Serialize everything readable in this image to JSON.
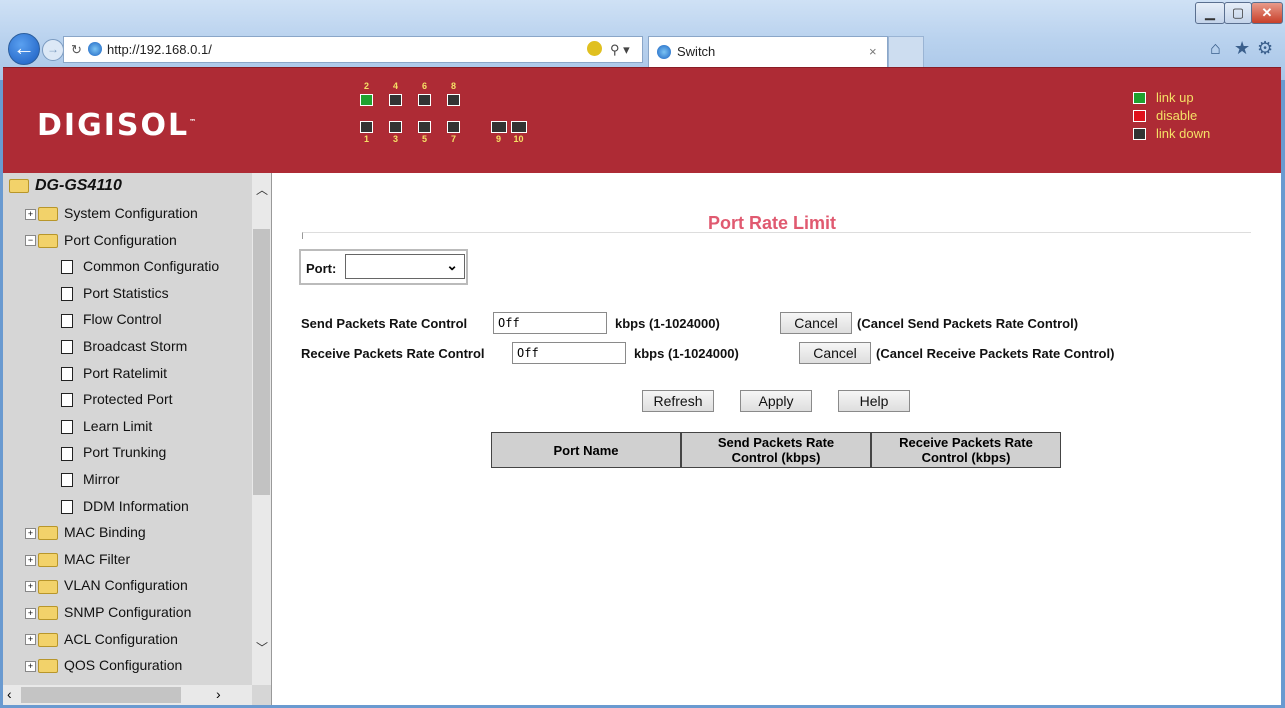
{
  "browser": {
    "url": "http://192.168.0.1/",
    "tab_title": "Switch",
    "tab_close": "×",
    "window_controls": [
      "minimize-icon",
      "maximize-icon",
      "close-icon"
    ],
    "toolbar_icons": [
      "home-icon",
      "favorites-star-icon",
      "settings-gear-icon"
    ]
  },
  "header": {
    "logo": "DIGISOL",
    "logo_tm": "™",
    "ports_top": [
      {
        "num": "2",
        "status": "link up"
      },
      {
        "num": "4",
        "status": "link down"
      },
      {
        "num": "6",
        "status": "link down"
      },
      {
        "num": "8",
        "status": "link down"
      }
    ],
    "ports_bottom": [
      {
        "num": "1",
        "status": "link down"
      },
      {
        "num": "3",
        "status": "link down"
      },
      {
        "num": "5",
        "status": "link down"
      },
      {
        "num": "7",
        "status": "link down"
      }
    ],
    "sfp_ports": [
      "9",
      "10"
    ],
    "legend": [
      {
        "label": "link up",
        "color": "#1fa12f"
      },
      {
        "label": "disable",
        "color": "#e0101a"
      },
      {
        "label": "link down",
        "color": "#333333"
      }
    ]
  },
  "sidebar": {
    "root": "DG-GS4110",
    "items": [
      {
        "label": "System Configuration",
        "kind": "folder",
        "expanded": false
      },
      {
        "label": "Port Configuration",
        "kind": "folder",
        "expanded": true
      },
      {
        "label": "Common Configuratio",
        "kind": "doc"
      },
      {
        "label": "Port Statistics",
        "kind": "doc"
      },
      {
        "label": "Flow Control",
        "kind": "doc"
      },
      {
        "label": "Broadcast Storm",
        "kind": "doc"
      },
      {
        "label": "Port Ratelimit",
        "kind": "doc"
      },
      {
        "label": "Protected Port",
        "kind": "doc"
      },
      {
        "label": "Learn Limit",
        "kind": "doc"
      },
      {
        "label": "Port Trunking",
        "kind": "doc"
      },
      {
        "label": "Mirror",
        "kind": "doc"
      },
      {
        "label": "DDM Information",
        "kind": "doc"
      },
      {
        "label": "MAC Binding",
        "kind": "folder",
        "expanded": false
      },
      {
        "label": "MAC Filter",
        "kind": "folder",
        "expanded": false
      },
      {
        "label": "VLAN Configuration",
        "kind": "folder",
        "expanded": false
      },
      {
        "label": "SNMP Configuration",
        "kind": "folder",
        "expanded": false
      },
      {
        "label": "ACL Configuration",
        "kind": "folder",
        "expanded": false
      },
      {
        "label": "QOS Configuration",
        "kind": "folder",
        "expanded": false
      }
    ]
  },
  "main": {
    "title": "Port Rate Limit",
    "port_label": "Port:",
    "port_value": "",
    "send": {
      "label": "Send Packets Rate Control",
      "value": "Off",
      "unit": "kbps (1-1024000)",
      "cancel": "Cancel",
      "cancel_desc": "(Cancel Send Packets Rate Control)"
    },
    "receive": {
      "label": "Receive Packets Rate Control",
      "value": "Off",
      "unit": "kbps (1-1024000)",
      "cancel": "Cancel",
      "cancel_desc": "(Cancel Receive Packets Rate Control)"
    },
    "buttons": {
      "refresh": "Refresh",
      "apply": "Apply",
      "help": "Help"
    },
    "table_headers": [
      "Port Name",
      "Send Packets Rate\nControl (kbps)",
      "Receive Packets Rate\nControl (kbps)"
    ]
  }
}
